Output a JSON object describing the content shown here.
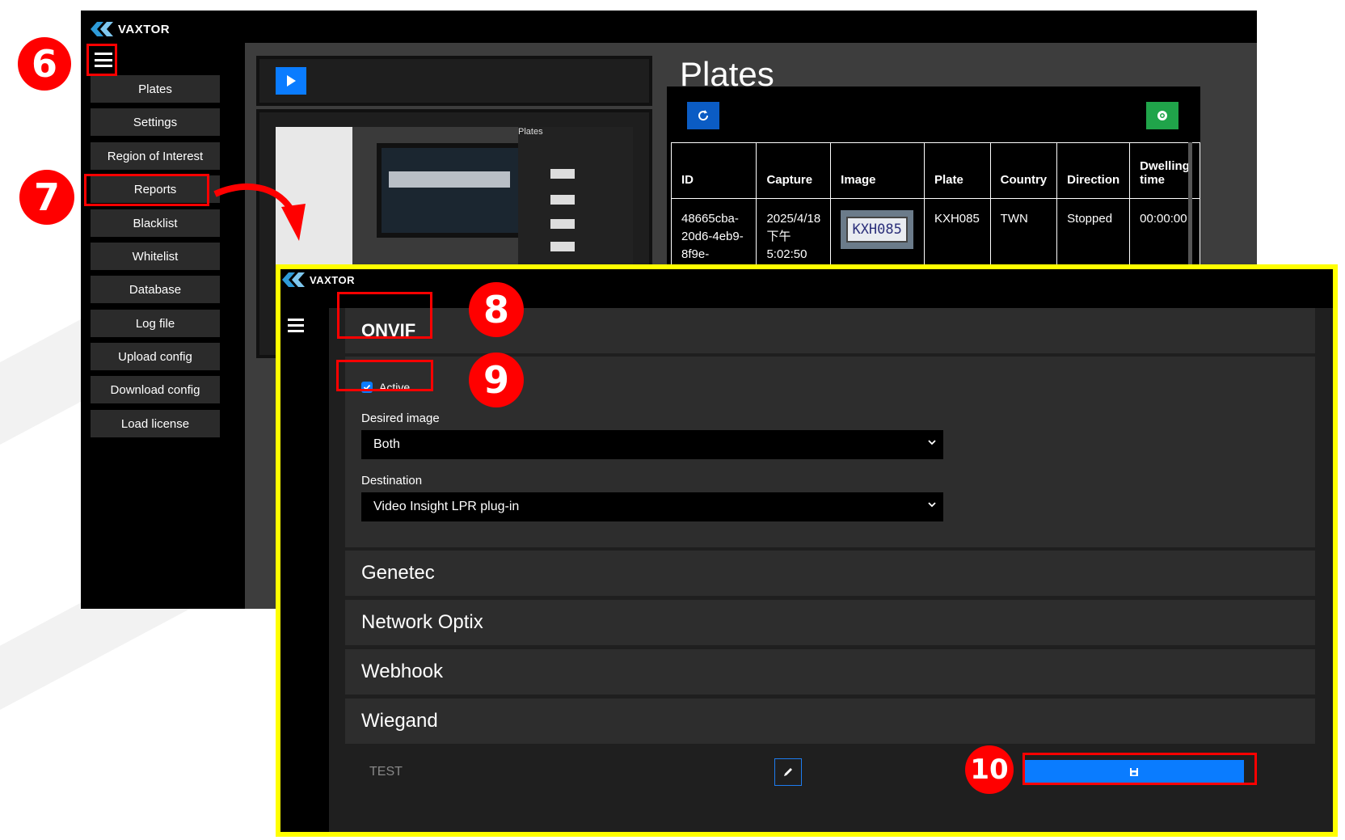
{
  "brand": {
    "logo_text": "VAXTOR"
  },
  "annotations": {
    "step6": "6",
    "step7": "7",
    "step8": "8",
    "step9": "9",
    "step10": "10"
  },
  "sidebar": {
    "items": [
      {
        "label": "Plates"
      },
      {
        "label": "Settings"
      },
      {
        "label": "Region of Interest"
      },
      {
        "label": "Reports"
      },
      {
        "label": "Blacklist"
      },
      {
        "label": "Whitelist"
      },
      {
        "label": "Database"
      },
      {
        "label": "Log file"
      },
      {
        "label": "Upload config"
      },
      {
        "label": "Download config"
      },
      {
        "label": "Load license"
      }
    ]
  },
  "plates_page": {
    "title": "Plates",
    "columns": [
      "ID",
      "Capture",
      "Image",
      "Plate",
      "Country",
      "Direction",
      "Dwelling time"
    ],
    "row": {
      "id": "48665cba-20d6-4eb9-8f9e-",
      "capture": "2025/4/18 下午 5:02:50",
      "plate": "KXH085",
      "plate_image_text": "KXH085",
      "country": "TWN",
      "direction": "Stopped",
      "dwelling": "00:00:00"
    },
    "thumbnail_label": "Plates"
  },
  "onvif_panel": {
    "title": "ONVIF",
    "active_label": "Active",
    "active_checked": true,
    "desired_image_label": "Desired image",
    "desired_image_value": "Both",
    "destination_label": "Destination",
    "destination_value": "Video Insight LPR plug-in"
  },
  "sections": [
    "Genetec",
    "Network Optix",
    "Webhook",
    "Wiegand"
  ],
  "footer": {
    "test_label": "TEST"
  },
  "colors": {
    "accent_blue": "#0a7cff",
    "annotation_red": "#ff0000",
    "highlight_yellow": "#ffff00",
    "green": "#20a44a"
  }
}
